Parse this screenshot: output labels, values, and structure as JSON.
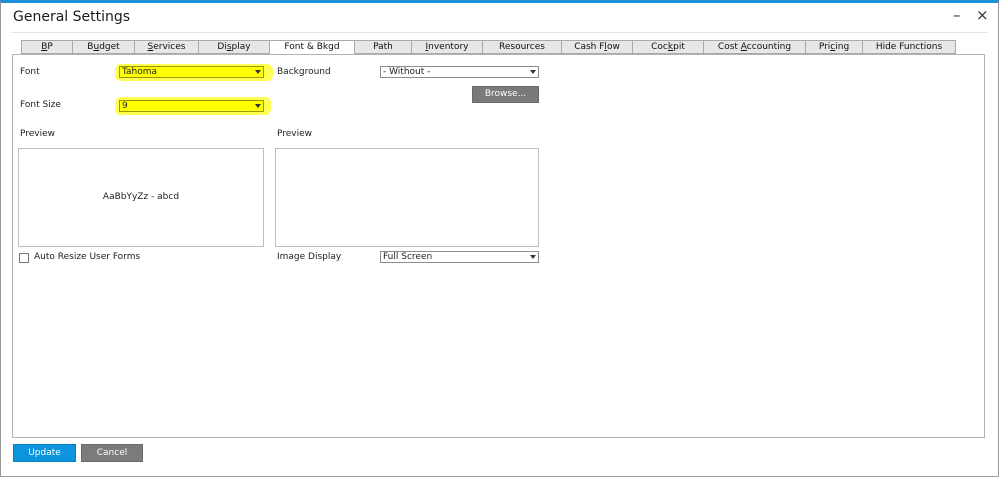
{
  "window": {
    "title": "General Settings",
    "minimize_glyph": "–",
    "close_glyph": "×"
  },
  "tabs": [
    {
      "pre": "",
      "key": "B",
      "post": "P"
    },
    {
      "pre": "B",
      "key": "u",
      "post": "dget"
    },
    {
      "pre": "",
      "key": "S",
      "post": "ervices"
    },
    {
      "pre": "Di",
      "key": "s",
      "post": "play"
    },
    {
      "pre": "Font & Bkgd",
      "key": "",
      "post": "",
      "active": true
    },
    {
      "pre": "Path",
      "key": "",
      "post": ""
    },
    {
      "pre": "",
      "key": "I",
      "post": "nventory"
    },
    {
      "pre": "Resources",
      "key": "",
      "post": ""
    },
    {
      "pre": "Cash F",
      "key": "l",
      "post": "ow"
    },
    {
      "pre": "Coc",
      "key": "k",
      "post": "pit"
    },
    {
      "pre": "Cost ",
      "key": "A",
      "post": "ccounting"
    },
    {
      "pre": "Pri",
      "key": "c",
      "post": "ing"
    },
    {
      "pre": "Hide Functions",
      "key": "",
      "post": ""
    }
  ],
  "font_section": {
    "font_label": "Font",
    "font_value": "Tahoma",
    "size_label": "Font Size",
    "size_value": "9",
    "preview_label": "Preview",
    "preview_text": "AaBbYyZz - abcd",
    "auto_resize_label": "Auto Resize User Forms",
    "auto_resize_checked": false
  },
  "background_section": {
    "background_label": "Background",
    "background_value": "- Without -",
    "browse_label": "Browse...",
    "preview_label": "Preview",
    "image_display_label": "Image Display",
    "image_display_value": "Full Screen"
  },
  "footer": {
    "update_label": "Update",
    "cancel_label": "Cancel"
  },
  "colors": {
    "accent": "#0c94dc",
    "highlight": "#ffff00",
    "gray_button": "#7a7a7a"
  }
}
